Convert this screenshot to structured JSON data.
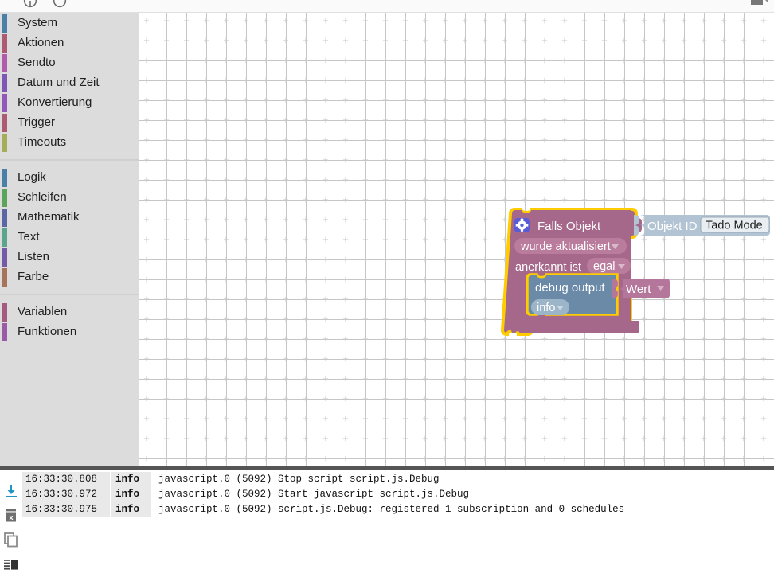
{
  "toolbar": {
    "icons": [
      {
        "name": "undo-icon"
      },
      {
        "name": "redo-icon"
      },
      {
        "name": "export-folder-icon"
      }
    ]
  },
  "toolbox": {
    "groups": [
      {
        "items": [
          {
            "label": "System",
            "color": "#4a7fa8"
          },
          {
            "label": "Aktionen",
            "color": "#ad5b73"
          },
          {
            "label": "Sendto",
            "color": "#b05cab"
          },
          {
            "label": "Datum und Zeit",
            "color": "#7d59b5"
          },
          {
            "label": "Konvertierung",
            "color": "#9458b8"
          },
          {
            "label": "Trigger",
            "color": "#ad5b73"
          },
          {
            "label": "Timeouts",
            "color": "#a5ad5b"
          }
        ]
      },
      {
        "items": [
          {
            "label": "Logik",
            "color": "#4a7fa8"
          },
          {
            "label": "Schleifen",
            "color": "#5ba55b"
          },
          {
            "label": "Mathematik",
            "color": "#5b67a5"
          },
          {
            "label": "Text",
            "color": "#5ba58c"
          },
          {
            "label": "Listen",
            "color": "#745ba5"
          },
          {
            "label": "Farbe",
            "color": "#a5745b"
          }
        ]
      },
      {
        "items": [
          {
            "label": "Variablen",
            "color": "#a55b80"
          },
          {
            "label": "Funktionen",
            "color": "#995ba5"
          }
        ]
      }
    ]
  },
  "canvas": {
    "blocks": {
      "if_object": {
        "title": "Falls Objekt",
        "settings_icon": "gear-icon",
        "dropdown_trigger": "wurde aktualisiert",
        "ack_label": "anerkannt ist",
        "ack_value": "egal",
        "color": "#a5678a",
        "selection_color": "#ffcc00"
      },
      "object_id": {
        "label": "Objekt ID",
        "value": "Tado Mode",
        "color": "#b2c4d4"
      },
      "debug_output": {
        "label": "debug output",
        "severity": "info",
        "color": "#6b8aa8"
      },
      "value_block": {
        "label": "Wert",
        "color": "#b5769b"
      }
    }
  },
  "log": {
    "tools": [
      {
        "name": "scroll-to-bottom-icon"
      },
      {
        "name": "clear-log-icon"
      },
      {
        "name": "copy-log-icon"
      },
      {
        "name": "log-layout-icon"
      }
    ],
    "columns": [
      "timestamp",
      "level",
      "message"
    ],
    "rows": [
      {
        "timestamp": "16:33:30.808",
        "level": "info",
        "message": "javascript.0 (5092) Stop script script.js.Debug"
      },
      {
        "timestamp": "16:33:30.972",
        "level": "info",
        "message": "javascript.0 (5092) Start javascript script.js.Debug"
      },
      {
        "timestamp": "16:33:30.975",
        "level": "info",
        "message": "javascript.0 (5092) script.js.Debug: registered 1 subscription and 0 schedules"
      }
    ]
  }
}
